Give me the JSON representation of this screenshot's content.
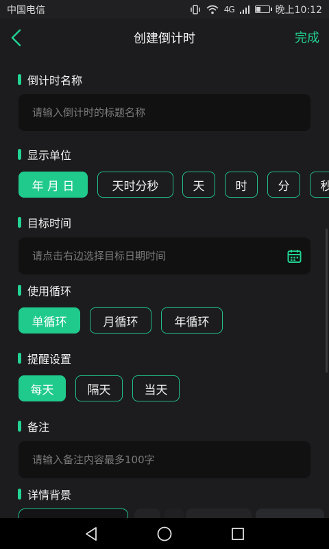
{
  "status_bar": {
    "carrier": "中国电信",
    "signal_text": "4G",
    "time": "晚上10:12",
    "battery_level": 0.35
  },
  "nav": {
    "title": "创建倒计时",
    "done_label": "完成"
  },
  "sections": {
    "name": {
      "label": "倒计时名称",
      "placeholder": "请输入倒计时的标题名称",
      "value": ""
    },
    "unit": {
      "label": "显示单位",
      "options": [
        "年 月 日",
        "天时分秒",
        "天",
        "时",
        "分",
        "秒"
      ],
      "selected": "年 月 日"
    },
    "target_time": {
      "label": "目标时间",
      "placeholder": "请点击右边选择目标日期时间",
      "value": ""
    },
    "loop": {
      "label": "使用循环",
      "options": [
        "单循环",
        "月循环",
        "年循环"
      ],
      "selected": "单循环"
    },
    "reminder": {
      "label": "提醒设置",
      "options": [
        "每天",
        "隔天",
        "当天"
      ],
      "selected": "每天"
    },
    "note": {
      "label": "备注",
      "placeholder": "请输入备注内容最多100字",
      "value": ""
    },
    "background": {
      "label": "详情背景"
    }
  },
  "colors": {
    "accent": "#21d292",
    "background": "#1c1c1e",
    "input_bg": "#111112"
  },
  "icons": {
    "back": "chevron-left-icon",
    "calendar": "calendar-icon",
    "nav_back": "triangle-back-icon",
    "nav_home": "circle-home-icon",
    "nav_recent": "square-recent-icon"
  }
}
